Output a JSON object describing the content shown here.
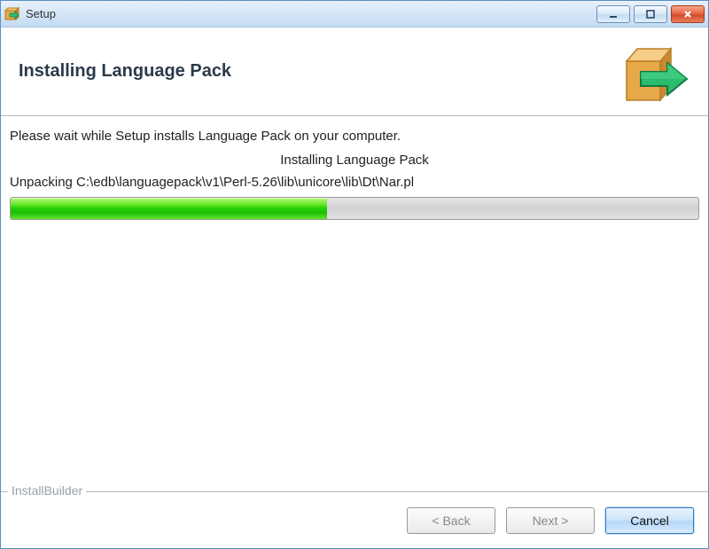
{
  "titlebar": {
    "title": "Setup"
  },
  "header": {
    "title": "Installing Language Pack"
  },
  "content": {
    "wait_text": "Please wait while Setup installs Language Pack on your computer.",
    "status_title": "Installing Language Pack",
    "status_file": "Unpacking C:\\edb\\languagepack\\v1\\Perl-5.26\\lib\\unicore\\lib\\Dt\\Nar.pl",
    "progress_percent": 46
  },
  "footer": {
    "brand": "InstallBuilder",
    "back_label": "< Back",
    "next_label": "Next >",
    "cancel_label": "Cancel"
  },
  "colors": {
    "progress_green": "#23cf05",
    "accent_blue": "#2f79c4"
  }
}
